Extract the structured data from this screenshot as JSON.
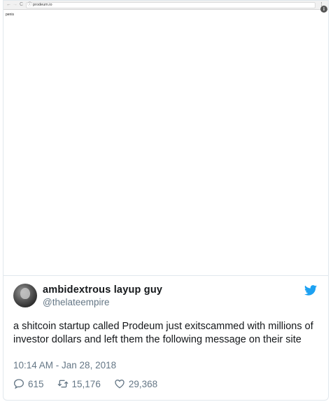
{
  "screenshot": {
    "browser": {
      "back": "←",
      "forward": "→",
      "reload": "C",
      "info": "ⓘ",
      "url": "prodeum.io",
      "menu": "⋮"
    },
    "page_text": "penis",
    "extension_badge": "i"
  },
  "tweet": {
    "display_name": "ambidextrous layup guy",
    "handle": "@thelateempire",
    "text": "a shitcoin startup called Prodeum just exitscammed with millions of investor dollars and left them the following message on their site",
    "timestamp": "10:14 AM - Jan 28, 2018",
    "replies": "615",
    "retweets": "15,176",
    "likes": "29,368",
    "brand_color": "#1da1f2",
    "icons": [
      "reply-icon",
      "retweet-icon",
      "like-icon",
      "twitter-bird-icon"
    ]
  }
}
